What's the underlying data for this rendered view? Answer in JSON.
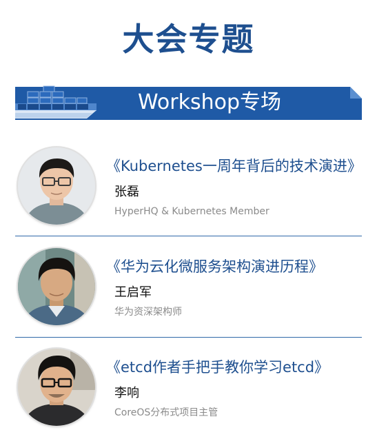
{
  "page_title": "大会专题",
  "banner": {
    "title": "Workshop专场",
    "icon": "container-ship-icon"
  },
  "speakers": [
    {
      "talk_title": "《Kubernetes一周年背后的技术演进》",
      "name": "张磊",
      "role": "HyperHQ & Kubernetes Member"
    },
    {
      "talk_title": "《华为云化微服务架构演进历程》",
      "name": "王启军",
      "role": "华为资深架构师"
    },
    {
      "talk_title": "《etcd作者手把手教你学习etcd》",
      "name": "李响",
      "role": "CoreOS分布式项目主管"
    }
  ],
  "colors": {
    "brand_blue": "#1e4f8f",
    "banner_blue": "#1f5aa6",
    "divider": "#2f67a8",
    "role_gray": "#8a8a8a"
  }
}
